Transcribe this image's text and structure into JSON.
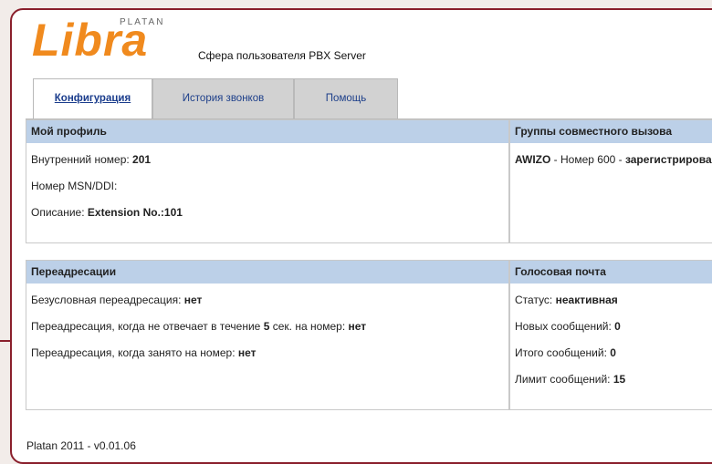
{
  "brand": {
    "logo_main": "Libra",
    "logo_top": "PLATAN",
    "subtitle": "Сфера пользователя PBX Server"
  },
  "tabs": [
    {
      "label": "Конфигурация",
      "active": true
    },
    {
      "label": "История звонков",
      "active": false
    },
    {
      "label": "Помощь",
      "active": false
    }
  ],
  "profile": {
    "title": "Мой профиль",
    "ext_label": "Внутренний номер: ",
    "ext_value": "201",
    "msn_label": "Номер MSN/DDI:",
    "desc_label": "Описание: ",
    "desc_value": "Extension No.:101"
  },
  "groups": {
    "title": "Группы совместного вызова",
    "item_name": "AWIZO",
    "item_text": " - Номер 600 - ",
    "item_status": "зарегистрирован"
  },
  "forwarding": {
    "title": "Переадресации",
    "unconditional_label": "Безусловная переадресация: ",
    "unconditional_value": "нет",
    "noanswer_label_1": "Переадресация, когда не отвечает в течение ",
    "noanswer_seconds": "5",
    "noanswer_label_2": " сек. на номер: ",
    "noanswer_value": "нет",
    "busy_label": "Переадресация, когда занято на номер: ",
    "busy_value": "нет"
  },
  "voicemail": {
    "title": "Голосовая почта",
    "status_label": "Статус: ",
    "status_value": "неактивная",
    "new_label": "Новых сообщений: ",
    "new_value": "0",
    "total_label": "Итого сообщений: ",
    "total_value": "0",
    "limit_label": "Лимит сообщений: ",
    "limit_value": "15"
  },
  "footer": "Platan 2011 - v0.01.06",
  "colors": {
    "accent": "#f08a1e",
    "frame": "#8a1f2c",
    "header_bg": "#bcd0e8",
    "tab_bg": "#d2d2d2",
    "link": "#1a3c8c"
  }
}
